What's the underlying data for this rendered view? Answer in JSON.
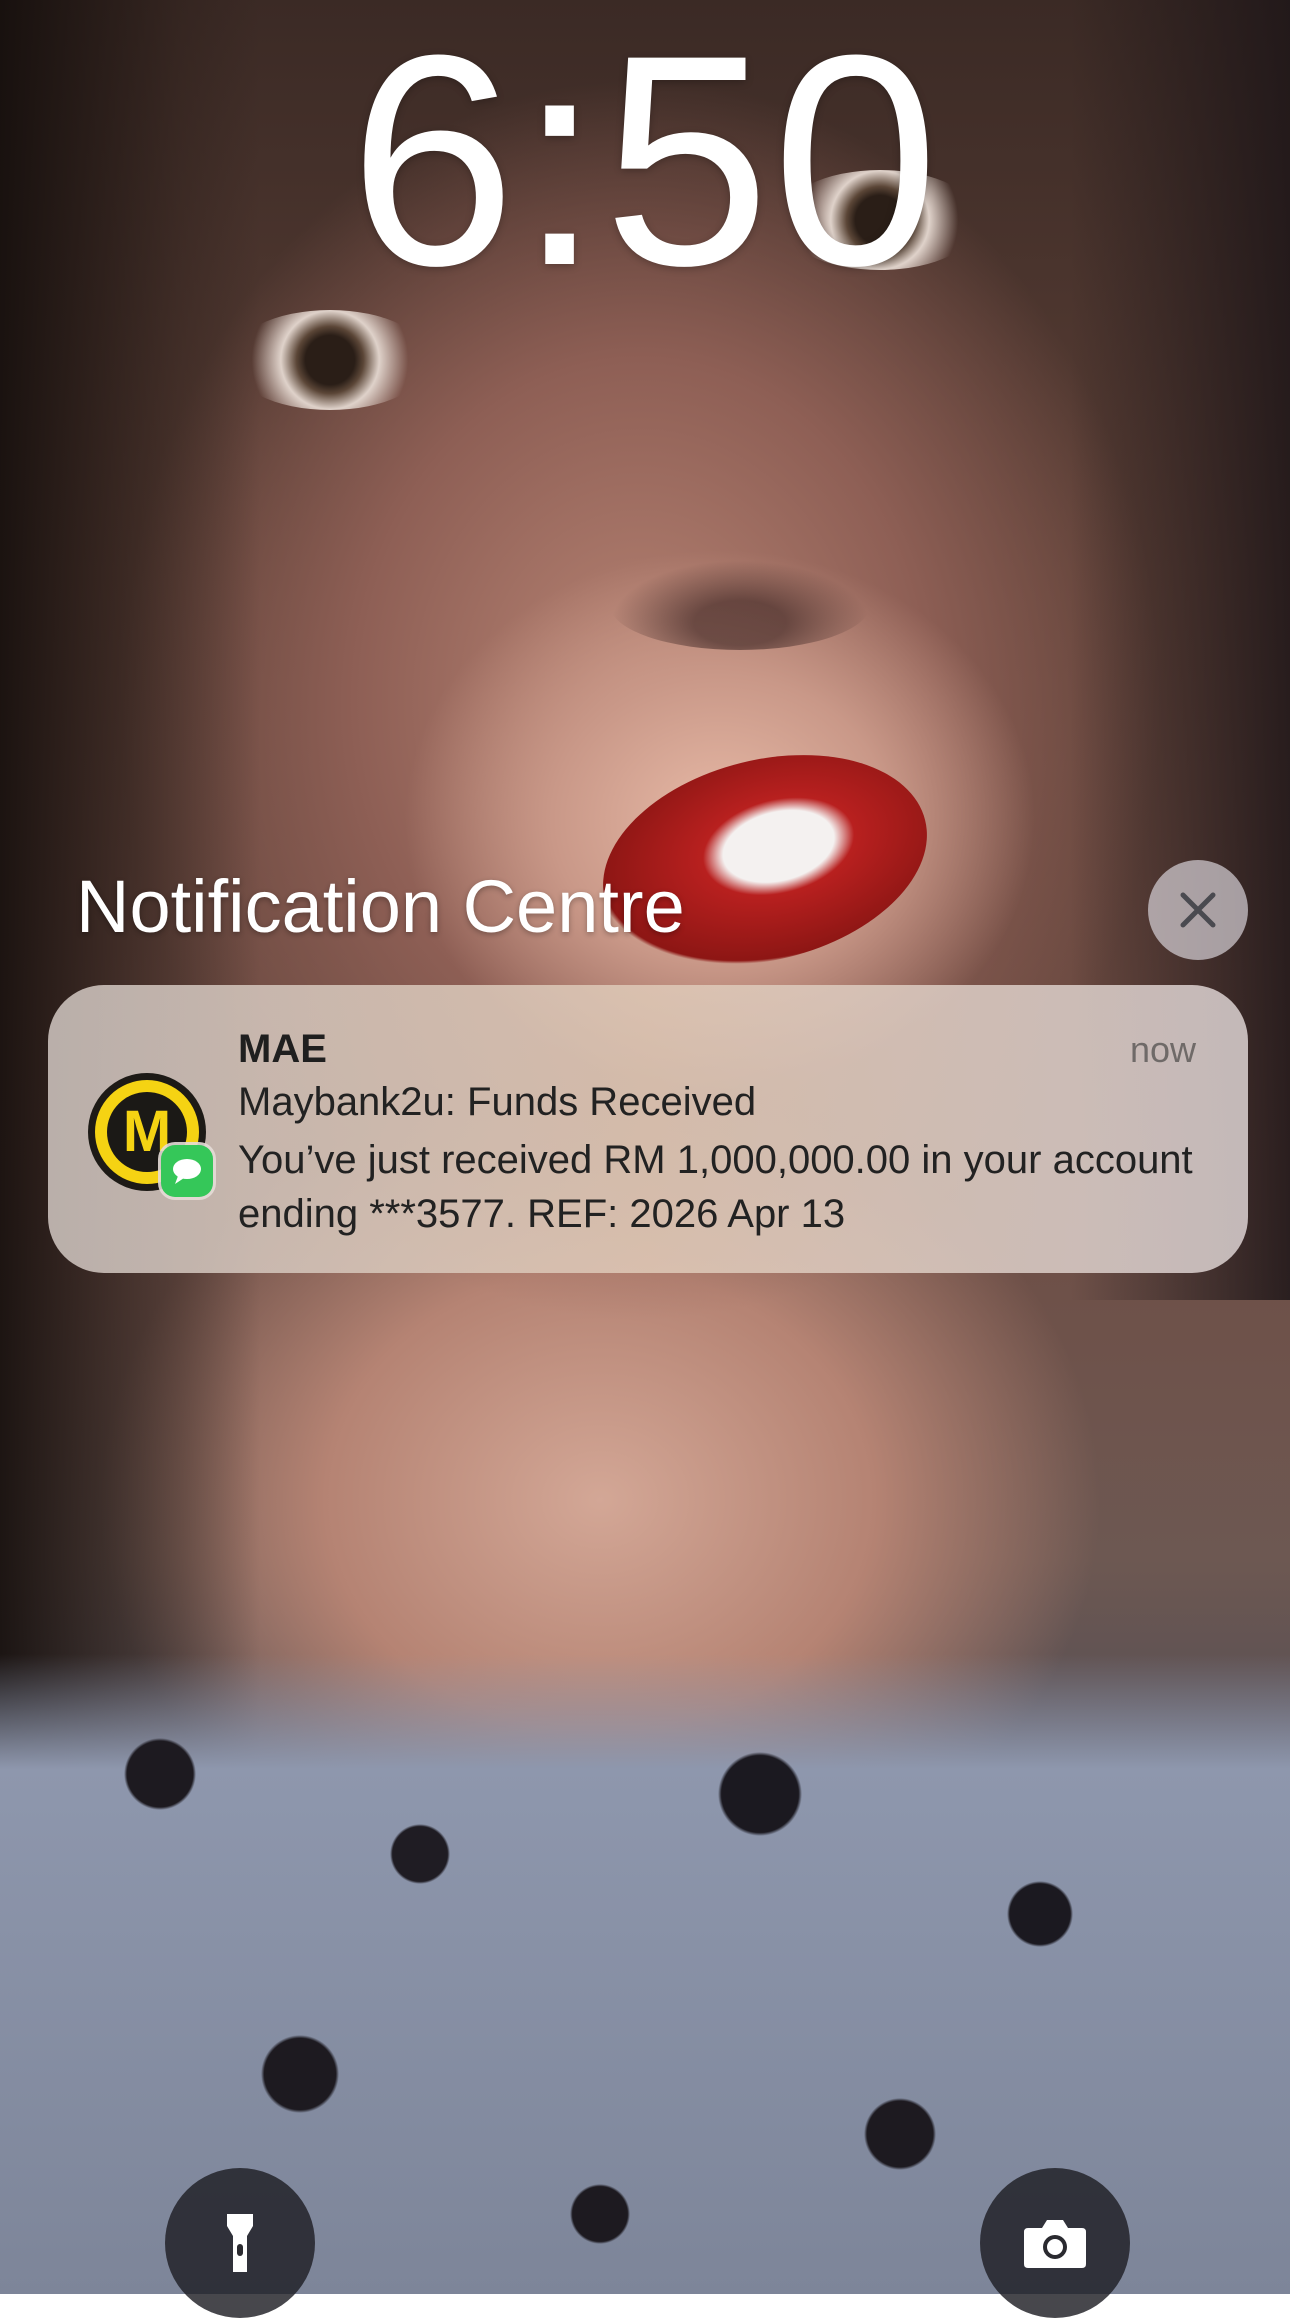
{
  "lock_screen": {
    "time": "6:50"
  },
  "notification_centre": {
    "title": "Notification Centre",
    "close_icon": "close-icon"
  },
  "notification": {
    "app_name": "MAE",
    "app_icon_letter": "M",
    "time": "now",
    "title": "Maybank2u: Funds Received",
    "body": "You’ve just received RM 1,000,000.00 in your account ending ***3577. REF: 2026 Apr 13",
    "icon_colors": {
      "ring": "#f5d313",
      "badge": "#35c759"
    }
  },
  "quick_actions": {
    "flashlight_icon": "flashlight-icon",
    "camera_icon": "camera-icon"
  }
}
